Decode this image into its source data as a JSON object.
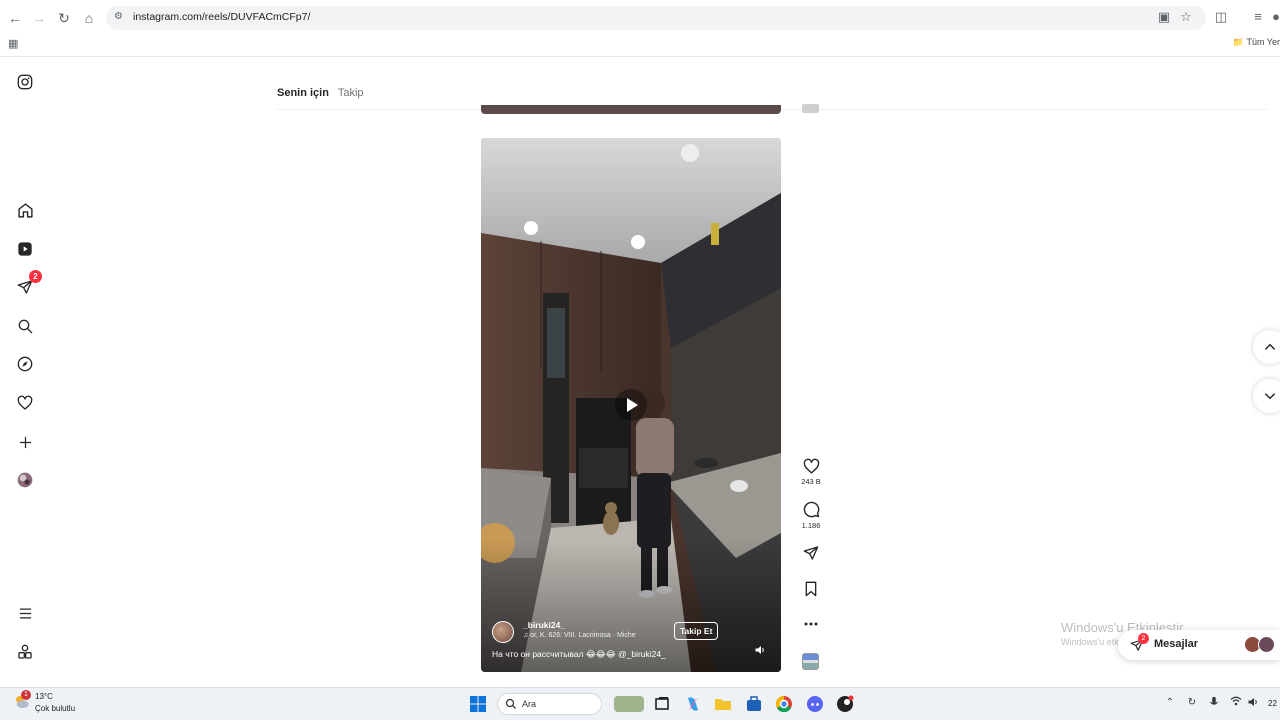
{
  "browser": {
    "url": "instagram.com/reels/DUVFACmCFp7/",
    "bookmarks_label": "Tüm Yer"
  },
  "sidebar": {
    "notifications_badge": "2",
    "items": [
      "instagram-logo",
      "home",
      "reels",
      "messages",
      "search",
      "explore",
      "notifications",
      "create",
      "profile",
      "more",
      "also-from-meta"
    ]
  },
  "feed_tabs": {
    "active": "Senin için",
    "inactive": "Takip"
  },
  "reel": {
    "username": "_biruki24_",
    "audio": "or, K. 626: VIII. Lacrimosa · Miche",
    "follow_label": "Takip Et",
    "caption": "На что он рассчитывал 😂😂😂 @_biruki24_"
  },
  "actions": {
    "likes": "243 B",
    "comments": "1.186"
  },
  "windows_watermark": {
    "line1": "Windows'u Etkinleştir",
    "line2": "Windows'u etkinleştirmek için Ayarlar'a gidin."
  },
  "messages": {
    "label": "Mesajlar",
    "badge": "2"
  },
  "taskbar": {
    "temperature": "13°C",
    "condition": "Çok bulutlu",
    "search_label": "Ara",
    "weather_badge": "1",
    "clock": "22"
  },
  "colors": {
    "accent_red": "#ff3040",
    "text": "#262626",
    "muted": "#737373"
  }
}
